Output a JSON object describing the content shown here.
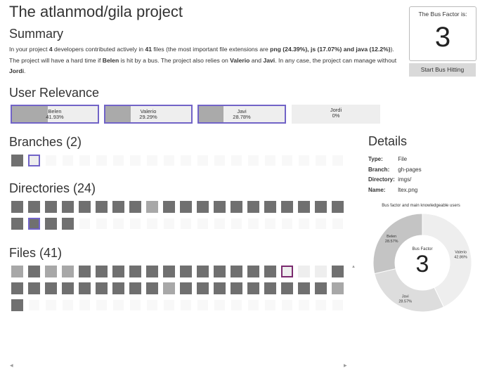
{
  "title": "The atlanmod/gila project",
  "summary": {
    "heading": "Summary",
    "t1": "In your project ",
    "devs": "4",
    "t2": " developers contributed actively in ",
    "files": "41",
    "t3": " files (the most important file extensions are ",
    "ext1": "png (24.39%), js (17.07%) and java (12.2%)",
    "t4": "). The project will have a hard time if ",
    "hit": "Belen",
    "t5": " is hit by a bus. The project also relies on ",
    "relies1": "Valerio",
    "t6": " and ",
    "relies2": "Javi",
    "t7": ". In any case, the project can manage without ",
    "without": "Jordi",
    "t8": "."
  },
  "bus_factor": {
    "label": "The Bus Factor is:",
    "value": "3",
    "button": "Start Bus Hitting"
  },
  "user_relevance": {
    "heading": "User Relevance",
    "users": [
      {
        "name": "Belen",
        "pct": "41.93%",
        "share": 0.4193,
        "selected": true
      },
      {
        "name": "Valerio",
        "pct": "29.29%",
        "share": 0.2929,
        "selected": true
      },
      {
        "name": "Javi",
        "pct": "28.78%",
        "share": 0.2878,
        "selected": true
      },
      {
        "name": "Jordi",
        "pct": "0%",
        "share": 0.0,
        "selected": false
      }
    ]
  },
  "branches": {
    "heading": "Branches (2)",
    "items": [
      "d",
      "e*p"
    ]
  },
  "directories": {
    "heading": "Directories (24)",
    "items": [
      "d",
      "d",
      "d",
      "d",
      "d",
      "d",
      "d",
      "d",
      "l",
      "d",
      "d",
      "d",
      "d",
      "d",
      "d",
      "d",
      "d",
      "d",
      "d",
      "d",
      "d",
      "d*p",
      "d",
      "d"
    ]
  },
  "files": {
    "heading": "Files (41)",
    "items": [
      "l",
      "d",
      "l",
      "l",
      "d",
      "d",
      "d",
      "d",
      "d",
      "d",
      "d",
      "d",
      "d",
      "d",
      "d",
      "d",
      "e*m",
      "e",
      "e",
      "d",
      "d",
      "d",
      "d",
      "d",
      "d",
      "d",
      "d",
      "d",
      "d",
      "l",
      "d",
      "d",
      "d",
      "d",
      "d",
      "d",
      "d",
      "d",
      "d",
      "l",
      "d"
    ]
  },
  "details": {
    "heading": "Details",
    "rows": [
      {
        "k": "Type:",
        "v": "File"
      },
      {
        "k": "Branch:",
        "v": "gh-pages"
      },
      {
        "k": "Directory:",
        "v": "imgs/"
      },
      {
        "k": "Name:",
        "v": "ltex.png"
      }
    ]
  },
  "chart_data": {
    "type": "pie",
    "title": "Bus factor and main knowledgeable users",
    "center_label": "Bus Factor",
    "center_value": "3",
    "slices": [
      {
        "name": "Valerio",
        "pct": "42.86%",
        "value": 42.86,
        "color": "#eeeeee"
      },
      {
        "name": "Javi",
        "pct": "28.57%",
        "value": 28.57,
        "color": "#dddddd"
      },
      {
        "name": "Belen",
        "pct": "28.57%",
        "value": 28.57,
        "color": "#c4c4c4"
      }
    ]
  }
}
